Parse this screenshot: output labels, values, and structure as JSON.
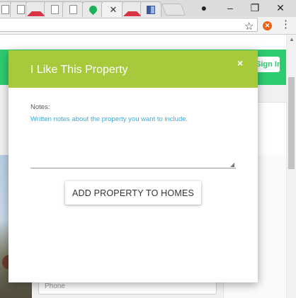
{
  "browser": {
    "tabs": [
      {
        "icon": "document-icon"
      },
      {
        "icon": "house-icon"
      },
      {
        "icon": "document-icon"
      },
      {
        "icon": "document-icon"
      },
      {
        "icon": "location-pin-icon"
      },
      {
        "icon": "close-icon",
        "active": true
      },
      {
        "icon": "house-icon"
      },
      {
        "icon": "grid-icon"
      }
    ],
    "window_controls": {
      "profile": "●",
      "minimize": "–",
      "restore": "❐",
      "close": "✕"
    },
    "toolbar": {
      "star": "☆",
      "extension_badge": "✕",
      "menu": "⋮"
    }
  },
  "page": {
    "sign_in_label": "Sign In",
    "phone_placeholder": "Phone",
    "accent_color": "#2ecc71"
  },
  "modal": {
    "title": "I Like This Property",
    "close_label": "×",
    "notes_label": "Notes:",
    "notes_placeholder": "Written notes about the property you want to include.",
    "notes_value": "",
    "add_button_label": "ADD PROPERTY TO HOMES",
    "header_color": "#a7c93c"
  }
}
